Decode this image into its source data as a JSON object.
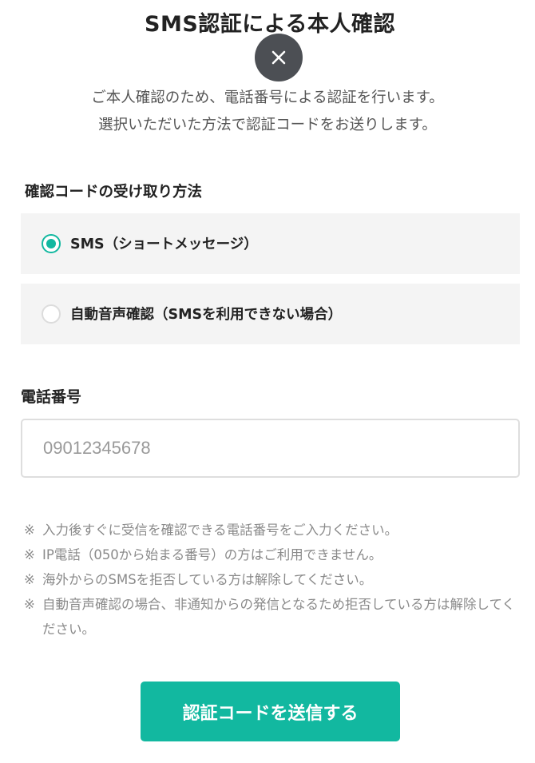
{
  "modal": {
    "title": "SMS認証による本人確認",
    "close_icon": "close-icon",
    "intro_lines": [
      "ご本人確認のため、電話番号による認証を行います。",
      "選択いただいた方法で認証コードをお送りします。"
    ]
  },
  "method": {
    "label": "確認コードの受け取り方法",
    "options": [
      {
        "label": "SMS（ショートメッセージ）",
        "selected": true
      },
      {
        "label": "自動音声確認（SMSを利用できない場合）",
        "selected": false
      }
    ]
  },
  "phone": {
    "label": "電話番号",
    "placeholder": "09012345678",
    "value": ""
  },
  "notes": {
    "mark": "※",
    "items": [
      "入力後すぐに受信を確認できる電話番号をご入力ください。",
      "IP電話（050から始まる番号）の方はご利用できません。",
      "海外からのSMSを拒否している方は解除してください。",
      "自動音声確認の場合、非通知からの発信となるため拒否している方は解除してください。"
    ]
  },
  "submit": {
    "label": "認証コードを送信する"
  },
  "colors": {
    "accent": "#12b8a0",
    "close_bg": "#4c4f54",
    "option_bg": "#f4f4f4",
    "note_text": "#8a8a8a"
  }
}
